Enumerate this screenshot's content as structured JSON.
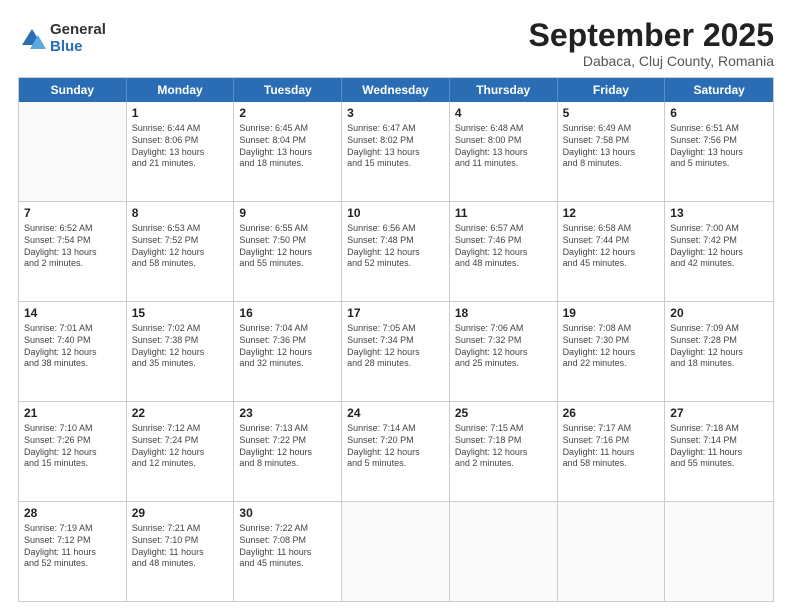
{
  "logo": {
    "general": "General",
    "blue": "Blue"
  },
  "title": "September 2025",
  "location": "Dabaca, Cluj County, Romania",
  "header_days": [
    "Sunday",
    "Monday",
    "Tuesday",
    "Wednesday",
    "Thursday",
    "Friday",
    "Saturday"
  ],
  "weeks": [
    [
      {
        "day": "",
        "info": ""
      },
      {
        "day": "1",
        "info": "Sunrise: 6:44 AM\nSunset: 8:06 PM\nDaylight: 13 hours\nand 21 minutes."
      },
      {
        "day": "2",
        "info": "Sunrise: 6:45 AM\nSunset: 8:04 PM\nDaylight: 13 hours\nand 18 minutes."
      },
      {
        "day": "3",
        "info": "Sunrise: 6:47 AM\nSunset: 8:02 PM\nDaylight: 13 hours\nand 15 minutes."
      },
      {
        "day": "4",
        "info": "Sunrise: 6:48 AM\nSunset: 8:00 PM\nDaylight: 13 hours\nand 11 minutes."
      },
      {
        "day": "5",
        "info": "Sunrise: 6:49 AM\nSunset: 7:58 PM\nDaylight: 13 hours\nand 8 minutes."
      },
      {
        "day": "6",
        "info": "Sunrise: 6:51 AM\nSunset: 7:56 PM\nDaylight: 13 hours\nand 5 minutes."
      }
    ],
    [
      {
        "day": "7",
        "info": "Sunrise: 6:52 AM\nSunset: 7:54 PM\nDaylight: 13 hours\nand 2 minutes."
      },
      {
        "day": "8",
        "info": "Sunrise: 6:53 AM\nSunset: 7:52 PM\nDaylight: 12 hours\nand 58 minutes."
      },
      {
        "day": "9",
        "info": "Sunrise: 6:55 AM\nSunset: 7:50 PM\nDaylight: 12 hours\nand 55 minutes."
      },
      {
        "day": "10",
        "info": "Sunrise: 6:56 AM\nSunset: 7:48 PM\nDaylight: 12 hours\nand 52 minutes."
      },
      {
        "day": "11",
        "info": "Sunrise: 6:57 AM\nSunset: 7:46 PM\nDaylight: 12 hours\nand 48 minutes."
      },
      {
        "day": "12",
        "info": "Sunrise: 6:58 AM\nSunset: 7:44 PM\nDaylight: 12 hours\nand 45 minutes."
      },
      {
        "day": "13",
        "info": "Sunrise: 7:00 AM\nSunset: 7:42 PM\nDaylight: 12 hours\nand 42 minutes."
      }
    ],
    [
      {
        "day": "14",
        "info": "Sunrise: 7:01 AM\nSunset: 7:40 PM\nDaylight: 12 hours\nand 38 minutes."
      },
      {
        "day": "15",
        "info": "Sunrise: 7:02 AM\nSunset: 7:38 PM\nDaylight: 12 hours\nand 35 minutes."
      },
      {
        "day": "16",
        "info": "Sunrise: 7:04 AM\nSunset: 7:36 PM\nDaylight: 12 hours\nand 32 minutes."
      },
      {
        "day": "17",
        "info": "Sunrise: 7:05 AM\nSunset: 7:34 PM\nDaylight: 12 hours\nand 28 minutes."
      },
      {
        "day": "18",
        "info": "Sunrise: 7:06 AM\nSunset: 7:32 PM\nDaylight: 12 hours\nand 25 minutes."
      },
      {
        "day": "19",
        "info": "Sunrise: 7:08 AM\nSunset: 7:30 PM\nDaylight: 12 hours\nand 22 minutes."
      },
      {
        "day": "20",
        "info": "Sunrise: 7:09 AM\nSunset: 7:28 PM\nDaylight: 12 hours\nand 18 minutes."
      }
    ],
    [
      {
        "day": "21",
        "info": "Sunrise: 7:10 AM\nSunset: 7:26 PM\nDaylight: 12 hours\nand 15 minutes."
      },
      {
        "day": "22",
        "info": "Sunrise: 7:12 AM\nSunset: 7:24 PM\nDaylight: 12 hours\nand 12 minutes."
      },
      {
        "day": "23",
        "info": "Sunrise: 7:13 AM\nSunset: 7:22 PM\nDaylight: 12 hours\nand 8 minutes."
      },
      {
        "day": "24",
        "info": "Sunrise: 7:14 AM\nSunset: 7:20 PM\nDaylight: 12 hours\nand 5 minutes."
      },
      {
        "day": "25",
        "info": "Sunrise: 7:15 AM\nSunset: 7:18 PM\nDaylight: 12 hours\nand 2 minutes."
      },
      {
        "day": "26",
        "info": "Sunrise: 7:17 AM\nSunset: 7:16 PM\nDaylight: 11 hours\nand 58 minutes."
      },
      {
        "day": "27",
        "info": "Sunrise: 7:18 AM\nSunset: 7:14 PM\nDaylight: 11 hours\nand 55 minutes."
      }
    ],
    [
      {
        "day": "28",
        "info": "Sunrise: 7:19 AM\nSunset: 7:12 PM\nDaylight: 11 hours\nand 52 minutes."
      },
      {
        "day": "29",
        "info": "Sunrise: 7:21 AM\nSunset: 7:10 PM\nDaylight: 11 hours\nand 48 minutes."
      },
      {
        "day": "30",
        "info": "Sunrise: 7:22 AM\nSunset: 7:08 PM\nDaylight: 11 hours\nand 45 minutes."
      },
      {
        "day": "",
        "info": ""
      },
      {
        "day": "",
        "info": ""
      },
      {
        "day": "",
        "info": ""
      },
      {
        "day": "",
        "info": ""
      }
    ]
  ]
}
